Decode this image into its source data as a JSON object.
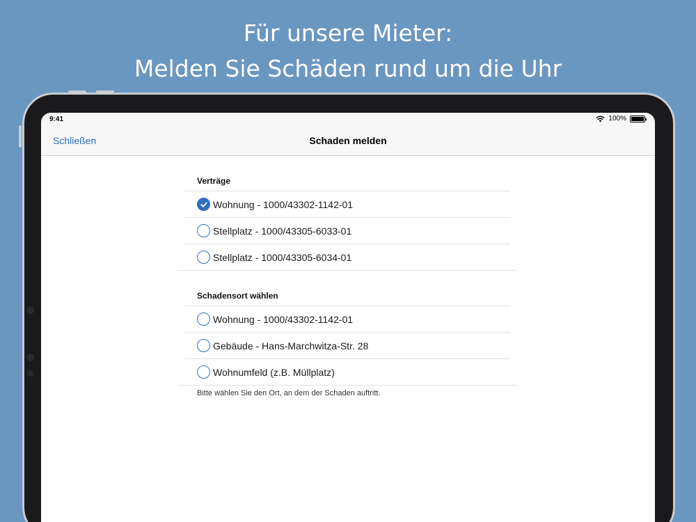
{
  "headline": {
    "line1": "Für unsere Mieter:",
    "line2": "Melden Sie Schäden rund um die Uhr"
  },
  "statusbar": {
    "time": "9:41",
    "battery": "100%",
    "battery_level": 1.0
  },
  "navbar": {
    "back_label": "Schließen",
    "title": "Schaden melden"
  },
  "contracts": {
    "header": "Verträge",
    "items": [
      {
        "label": "Wohnung - 1000/43302-1142-01",
        "selected": true
      },
      {
        "label": "Stellplatz - 1000/43305-6033-01",
        "selected": false
      },
      {
        "label": "Stellplatz - 1000/43305-6034-01",
        "selected": false
      }
    ]
  },
  "location": {
    "header": "Schadensort wählen",
    "items": [
      {
        "label": "Wohnung - 1000/43302-1142-01",
        "selected": false
      },
      {
        "label": "Gebäude - Hans-Marchwitza-Str. 28",
        "selected": false
      },
      {
        "label": "Wohnumfeld (z.B. Müllplatz)",
        "selected": false
      }
    ],
    "footer": "Bitte wählen Sie den Ort, an dem der Schaden auftritt."
  },
  "colors": {
    "background": "#6a97c0",
    "accent": "#2f6fbf"
  }
}
